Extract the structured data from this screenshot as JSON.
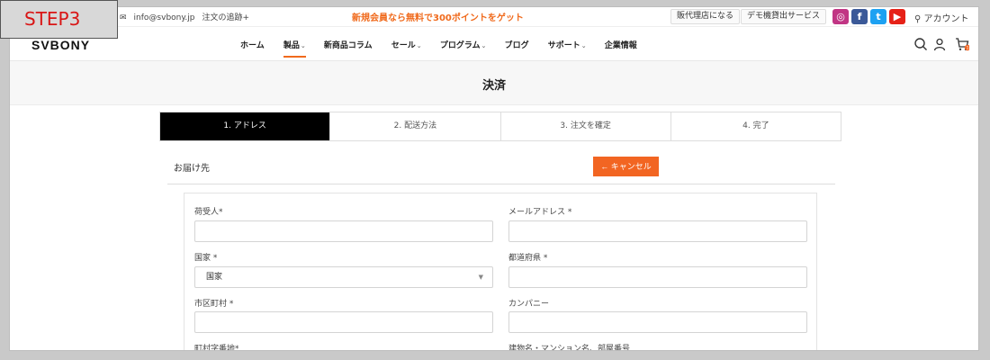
{
  "badge": "STEP3",
  "topbar": {
    "email": "info@svbony.jp",
    "tracking": "注文の追跡+",
    "promo": "新規会員なら無料で300ポイントをゲット",
    "dealer": "販代理店になる",
    "demo": "デモ機貸出サービス",
    "account": "アカウント"
  },
  "header": {
    "logo": "SVBONY",
    "nav": [
      {
        "label": "ホーム",
        "caret": ""
      },
      {
        "label": "製品",
        "caret": "⌄"
      },
      {
        "label": "新商品コラム",
        "caret": ""
      },
      {
        "label": "セール",
        "caret": "⌄"
      },
      {
        "label": "プログラム",
        "caret": "⌄"
      },
      {
        "label": "ブログ",
        "caret": ""
      },
      {
        "label": "サポート",
        "caret": "⌄"
      },
      {
        "label": "企業情報",
        "caret": ""
      }
    ],
    "cart_count": "1"
  },
  "page": {
    "title": "決済"
  },
  "steps": [
    "1. アドレス",
    "2. 配送方法",
    "3. 注文を確定",
    "4. 完了"
  ],
  "section": {
    "title": "お届け先",
    "cancel": "← キャンセル"
  },
  "form": {
    "recipient": "荷受人*",
    "email": "メールアドレス *",
    "country": "国家 *",
    "country_value": "国家",
    "prefecture": "都道府県 *",
    "city": "市区町村 *",
    "company": "カンパニー",
    "street": "町村字番地*",
    "building": "建物名・マンション名、部屋番号"
  },
  "colors": {
    "accent": "#f26522",
    "badge_text": "#d91515"
  },
  "icons": [
    "mail-icon",
    "instagram-icon",
    "facebook-icon",
    "twitter-icon",
    "youtube-icon",
    "user-icon",
    "search-icon",
    "cart-icon"
  ]
}
